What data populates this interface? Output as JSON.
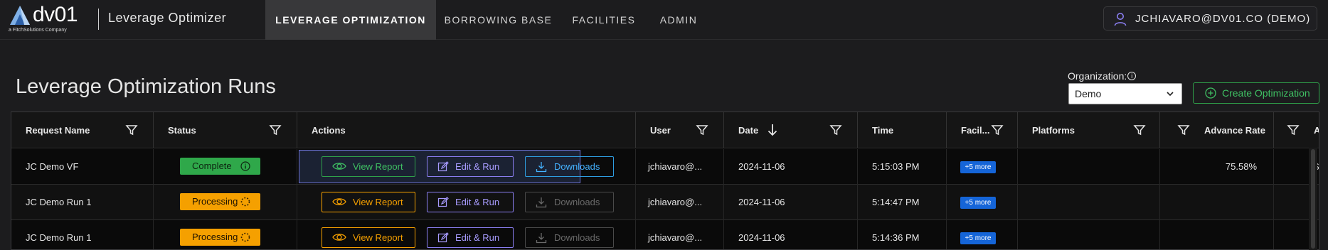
{
  "brand": {
    "logo_text": "dv01",
    "logo_sub": "a FitchSolutions Company",
    "app_title": "Leverage Optimizer"
  },
  "nav": {
    "tabs": [
      {
        "label": "LEVERAGE OPTIMIZATION",
        "active": true
      },
      {
        "label": "BORROWING BASE",
        "active": false
      },
      {
        "label": "FACILITIES",
        "active": false
      },
      {
        "label": "ADMIN",
        "active": false
      }
    ],
    "user": "JCHIAVARO@DV01.CO (DEMO)"
  },
  "page": {
    "title": "Leverage Optimization Runs",
    "org_label": "Organization:",
    "org_value": "Demo",
    "create_button": "Create Optimization"
  },
  "table": {
    "columns": [
      "Request Name",
      "Status",
      "Actions",
      "User",
      "Date",
      "Time",
      "Facil...",
      "Platforms",
      "Advance Rate",
      "A"
    ],
    "sort": {
      "column": "Date",
      "direction": "desc"
    },
    "action_labels": {
      "view": "View Report",
      "edit": "Edit & Run",
      "downloads": "Downloads"
    },
    "rows": [
      {
        "request_name": "JC Demo VF",
        "status": "Complete",
        "user": "jchiavaro@...",
        "date": "2024-11-06",
        "time": "5:15:03 PM",
        "facilities": "+5 more",
        "platforms": "",
        "advance_rate": "75.58%",
        "extra": "$",
        "downloads_enabled": true,
        "selected": true
      },
      {
        "request_name": "JC Demo Run 1",
        "status": "Processing",
        "user": "jchiavaro@...",
        "date": "2024-11-06",
        "time": "5:14:47 PM",
        "facilities": "+5 more",
        "platforms": "",
        "advance_rate": "",
        "extra": "",
        "downloads_enabled": false,
        "selected": false
      },
      {
        "request_name": "JC Demo Run 1",
        "status": "Processing",
        "user": "jchiavaro@...",
        "date": "2024-11-06",
        "time": "5:14:36 PM",
        "facilities": "+5 more",
        "platforms": "",
        "advance_rate": "",
        "extra": "",
        "downloads_enabled": false,
        "selected": false
      }
    ]
  },
  "colors": {
    "complete": "#2fa84a",
    "processing": "#f5a000",
    "edit": "#8a7ef0",
    "download": "#2e9ee0",
    "badge": "#1565d8"
  }
}
